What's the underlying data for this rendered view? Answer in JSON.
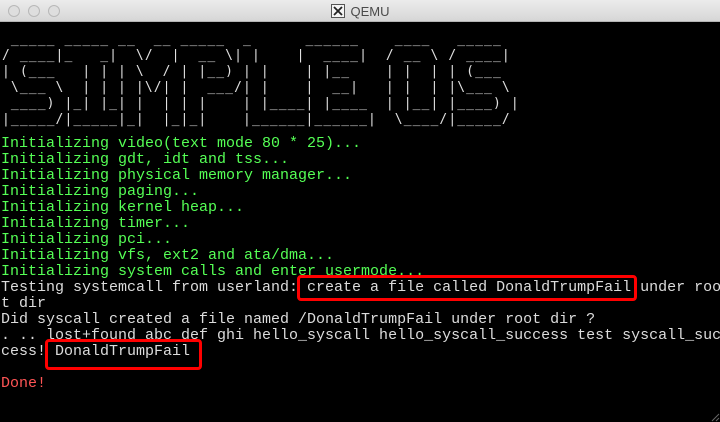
{
  "window": {
    "title": "QEMU",
    "app_icon": "x11-icon"
  },
  "banner": " _____ _____ __  __ _____  _      ______    ____   _____\n/ ____|_   _|  \\/  |  __ \\| |    |  ____|  / __ \\ / ____|\n| (___   | | | \\  / | |__) | |    | |__    | |  | | (___\n \\___ \\  | | | |\\/| |  ___/| |    |  __|   | |  | |\\___ \\\n ____) |_| |_| |  | | |    | |____| |____  | |__| |____) |\n|_____/|_____|_|  |_|_|    |______|______|  \\____/|_____/",
  "terminal": {
    "init_lines": [
      "Initializing video(text mode 80 * 25)...",
      "Initializing gdt, idt and tss...",
      "Initializing physical memory manager...",
      "Initializing paging...",
      "Initializing kernel heap...",
      "Initializing timer...",
      "Initializing pci...",
      "Initializing vfs, ext2 and ata/dma...",
      "Initializing system calls and enter usermode..."
    ],
    "output_lines": [
      "Testing systemcall from userland: create a file called DonaldTrumpFail under roo",
      "t dir",
      "Did syscall created a file named /DonaldTrumpFail under root dir ?",
      ". .. lost+found abc def ghi hello_syscall hello_syscall_success test syscall_suc",
      "cess! DonaldTrumpFail"
    ],
    "done_line": "Done!",
    "colors": {
      "init": "#55ff55",
      "output": "#dcdcdc",
      "done": "#ff5555",
      "highlight": "#ff0000"
    }
  }
}
